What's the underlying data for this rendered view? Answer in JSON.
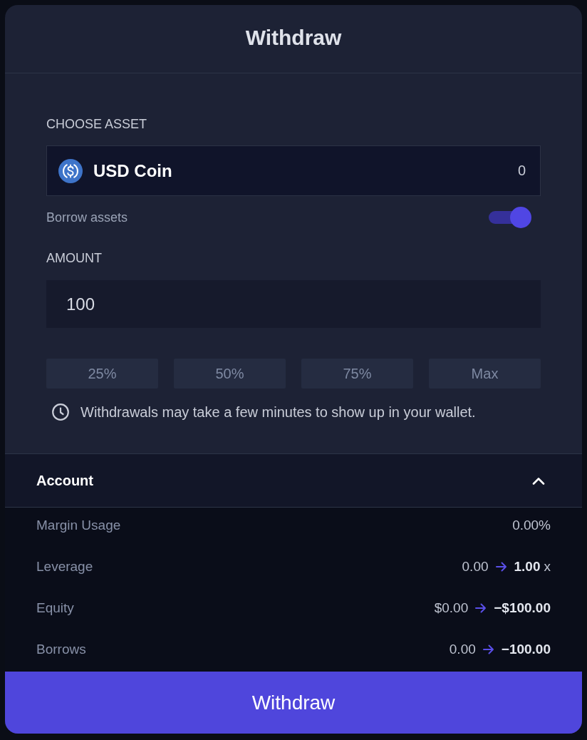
{
  "modal": {
    "title": "Withdraw"
  },
  "asset": {
    "label": "CHOOSE ASSET",
    "name": "USD Coin",
    "balance": "0"
  },
  "borrow": {
    "label": "Borrow assets",
    "on": true
  },
  "amount": {
    "label": "AMOUNT",
    "value": "100"
  },
  "presets": [
    "25%",
    "50%",
    "75%",
    "Max"
  ],
  "note": "Withdrawals may take a few minutes to show up in your wallet.",
  "account": {
    "title": "Account",
    "expanded": true,
    "rows": [
      {
        "kind": "value",
        "label": "Margin Usage",
        "value": "0.00%"
      },
      {
        "kind": "change",
        "label": "Leverage",
        "from": "0.00",
        "to": "1.00",
        "unit": "x"
      },
      {
        "kind": "change",
        "label": "Equity",
        "from": "$0.00",
        "to": "−$100.00"
      },
      {
        "kind": "change",
        "label": "Borrows",
        "from": "0.00",
        "to": "−100.00"
      }
    ]
  },
  "submit": {
    "label": "Withdraw"
  }
}
